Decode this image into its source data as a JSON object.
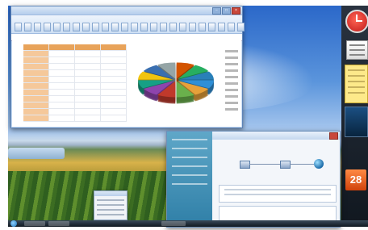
{
  "desktop": {
    "sidebar_calendar_day": "28"
  },
  "excel": {
    "title": "",
    "ribbon_tabs": [
      "",
      "",
      "",
      "",
      "",
      "",
      ""
    ],
    "formula_text": "",
    "table": {
      "headers": [
        "",
        "",
        "",
        ""
      ],
      "rows": [
        [
          "",
          "",
          "",
          ""
        ],
        [
          "",
          "",
          "",
          ""
        ],
        [
          "",
          "",
          "",
          ""
        ],
        [
          "",
          "",
          "",
          ""
        ],
        [
          "",
          "",
          "",
          ""
        ],
        [
          "",
          "",
          "",
          ""
        ],
        [
          "",
          "",
          "",
          ""
        ],
        [
          "",
          "",
          "",
          ""
        ],
        [
          "",
          "",
          "",
          ""
        ],
        [
          "",
          "",
          "",
          ""
        ],
        [
          "",
          "",
          "",
          ""
        ]
      ]
    },
    "pie_colors": [
      "#2f8fd6",
      "#e7a13a",
      "#6ab04c",
      "#c0392b",
      "#8e44ad",
      "#16a085",
      "#f1c40f",
      "#3a6fb0",
      "#95a5a6",
      "#d35400",
      "#27ae60",
      "#2980b9"
    ]
  },
  "network_window": {
    "heading": "",
    "labels": [
      "",
      "",
      ""
    ]
  },
  "colors": {
    "accent": "#2f7fa7",
    "taskbar": "#101820"
  }
}
